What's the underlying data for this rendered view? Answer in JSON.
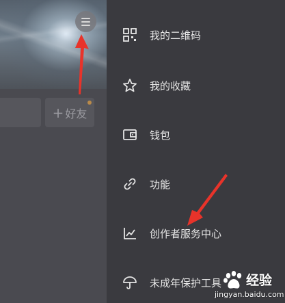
{
  "profile": {
    "add_friend_prefix": "+",
    "add_friend_label": "好友"
  },
  "drawer": {
    "items": [
      {
        "label": "我的二维码",
        "icon": "qr-code-icon"
      },
      {
        "label": "我的收藏",
        "icon": "star-icon"
      },
      {
        "label": "钱包",
        "icon": "wallet-icon"
      },
      {
        "label": "功能",
        "icon": "link-icon"
      },
      {
        "label": "创作者服务中心",
        "icon": "chart-icon"
      },
      {
        "label": "未成年保护工具",
        "icon": "umbrella-icon"
      }
    ]
  },
  "annotations": {
    "arrow_color": "#e8332a"
  },
  "watermark": {
    "brand": "Bai",
    "text": "经验",
    "url": "jingyan.baidu.com"
  }
}
